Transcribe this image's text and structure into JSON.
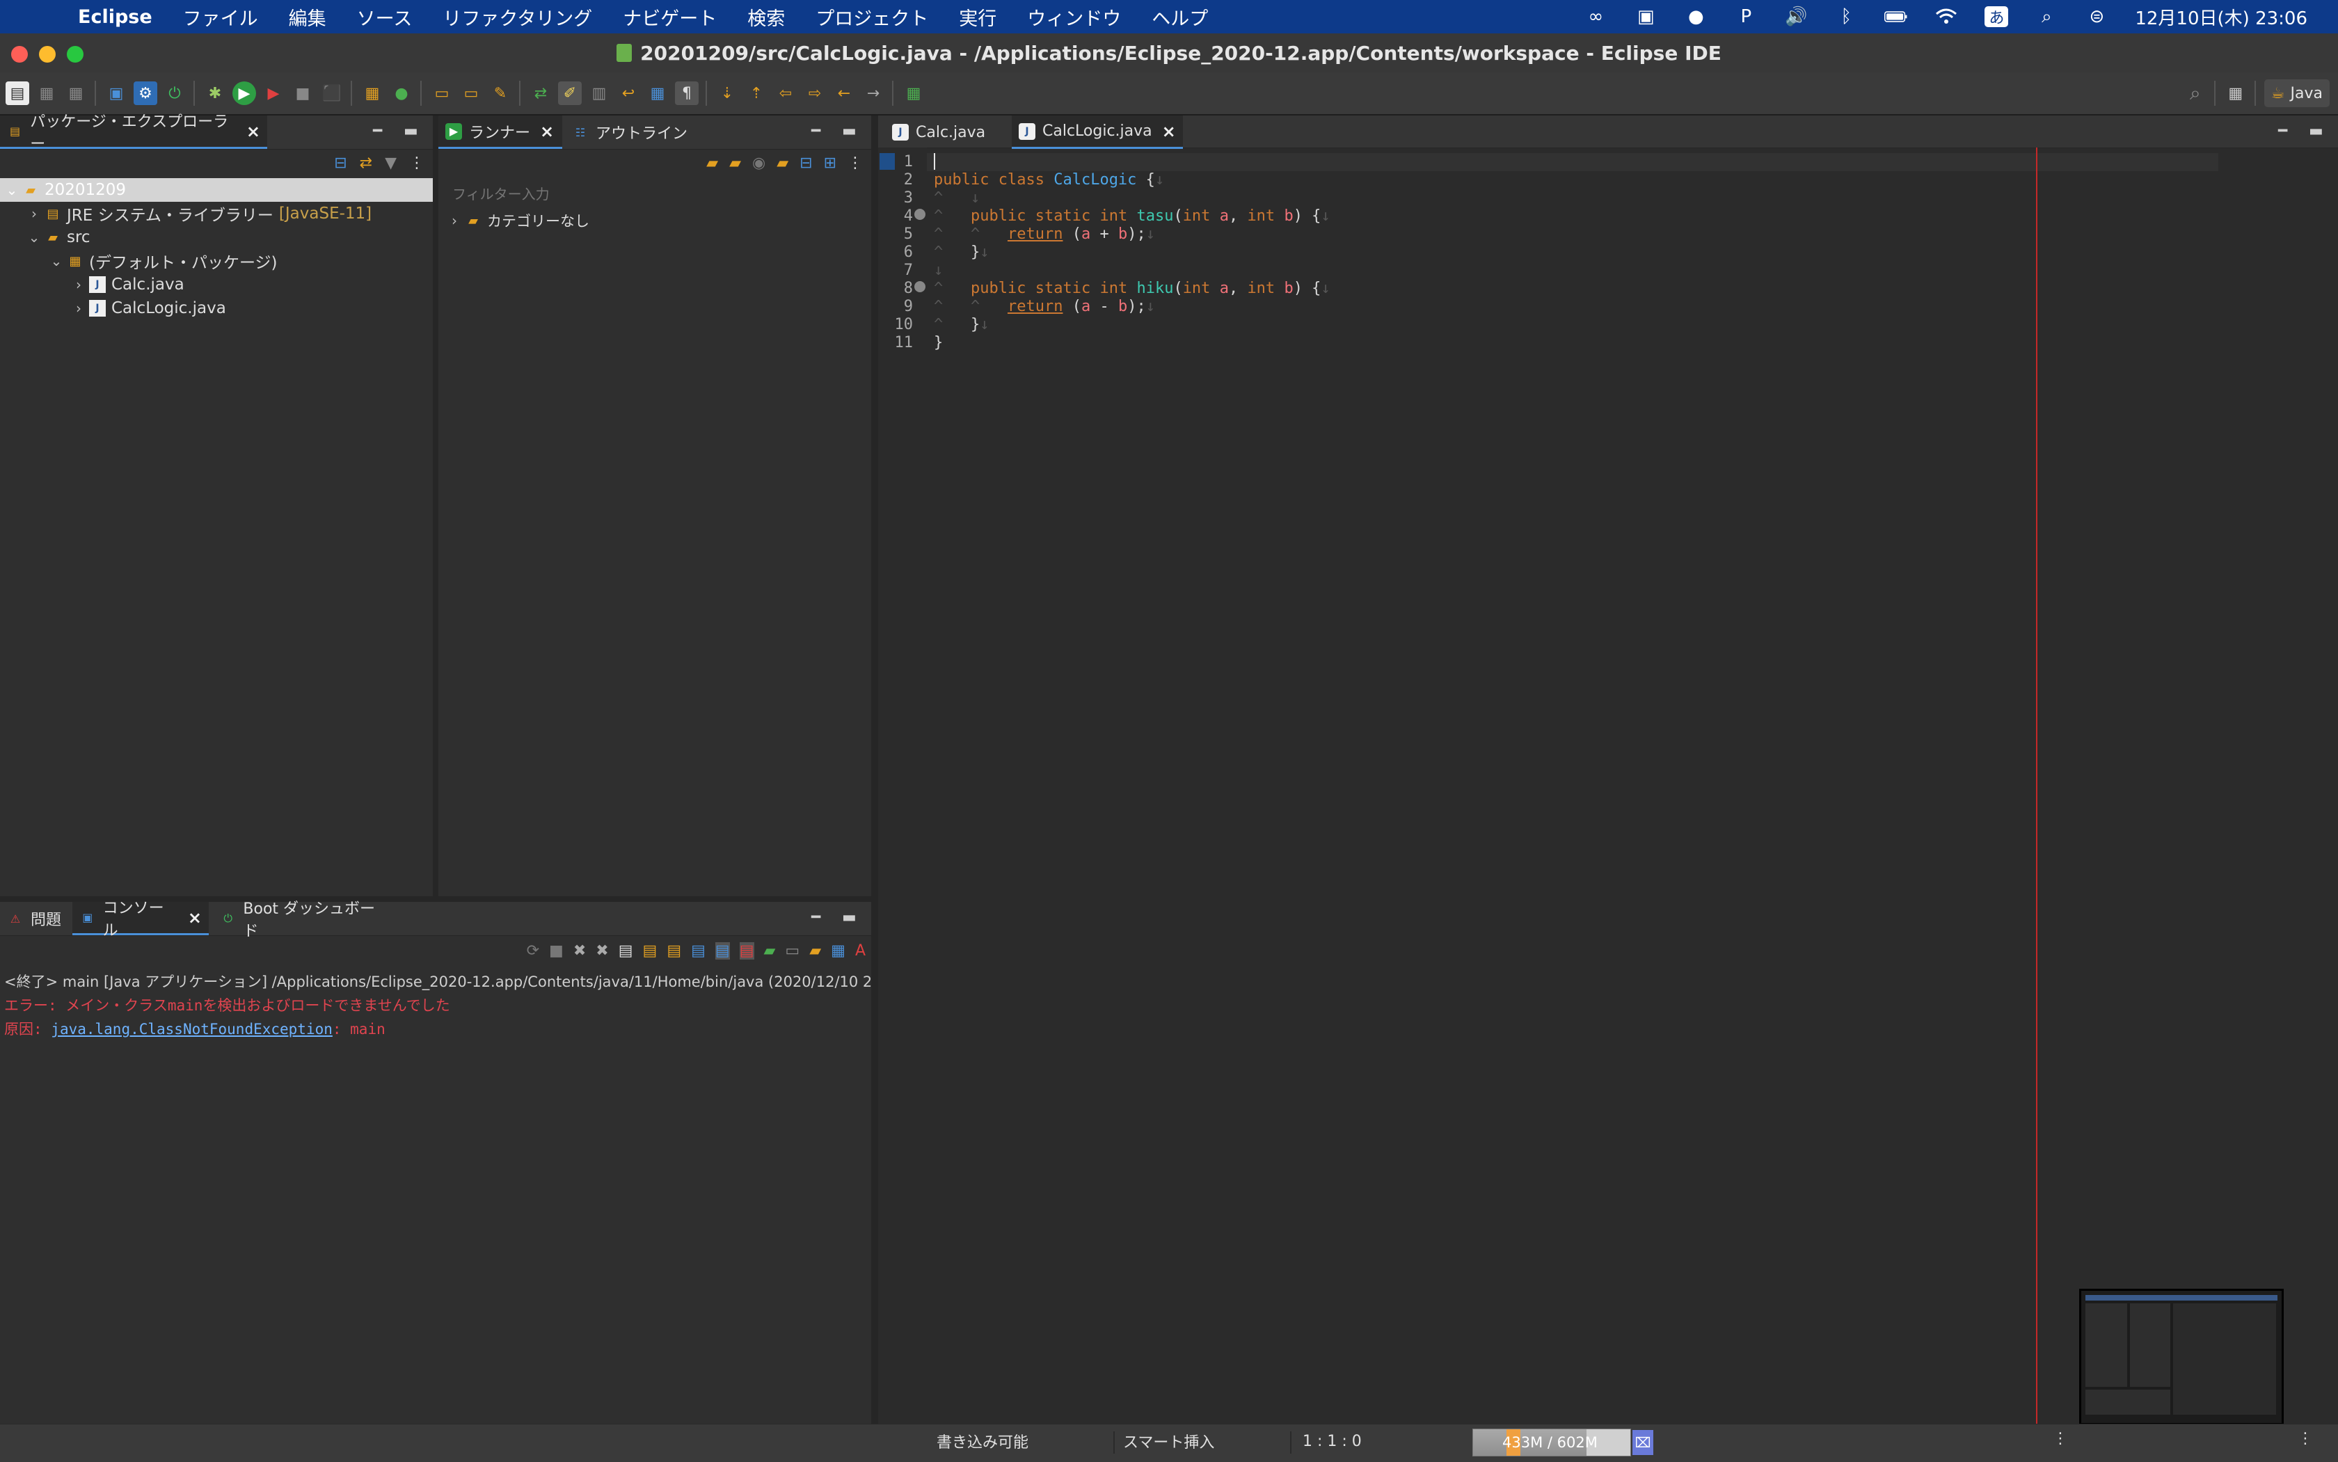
{
  "menubar": {
    "app_name": "Eclipse",
    "items": [
      "ファイル",
      "編集",
      "ソース",
      "リファクタリング",
      "ナビゲート",
      "検索",
      "プロジェクト",
      "実行",
      "ウィンドウ",
      "ヘルプ"
    ],
    "clock": "12月10日(木)  23:06",
    "input_method": "あ"
  },
  "window": {
    "title": "20201209/src/CalcLogic.java - /Applications/Eclipse_2020-12.app/Contents/workspace - Eclipse IDE"
  },
  "toolbar": {
    "perspective_label": "Java"
  },
  "package_explorer": {
    "tab_label": "パッケージ・エクスプローラー",
    "tree": {
      "project": "20201209",
      "jre_label": "JRE システム・ライブラリー",
      "jre_version": "[JavaSE-11]",
      "src": "src",
      "default_package": "(デフォルト・パッケージ)",
      "files": [
        "Calc.java",
        "CalcLogic.java"
      ]
    }
  },
  "runner_panel": {
    "tab_runner": "ランナー",
    "tab_outline": "アウトライン",
    "filter_placeholder": "フィルター入力",
    "category": "カテゴリーなし"
  },
  "console_panel": {
    "tab_problems": "問題",
    "tab_console": "コンソール",
    "tab_boot": "Boot ダッシュボード",
    "header_line": "<終了> main [Java アプリケーション] /Applications/Eclipse_2020-12.app/Contents/java/11/Home/bin/java  (2020/12/10 2",
    "error_line": "エラー: メイン・クラスmainを検出およびロードできませんでした",
    "cause_prefix": "原因: ",
    "cause_link": "java.lang.ClassNotFoundException",
    "cause_suffix": ": main"
  },
  "editor": {
    "tabs": [
      {
        "label": "Calc.java",
        "active": false
      },
      {
        "label": "CalcLogic.java",
        "active": true
      }
    ],
    "line_numbers": [
      "1",
      "2",
      "3",
      "4",
      "5",
      "6",
      "7",
      "8",
      "9",
      "10",
      "11"
    ],
    "code": {
      "l2_public": "public",
      "l2_class": "class",
      "l2_name": "CalcLogic",
      "l2_brace": " {",
      "m_public": "public",
      "m_static": "static",
      "m_int": "int",
      "m1_name": "tasu",
      "m2_name": "hiku",
      "p_int": "int",
      "p_a": "a",
      "p_b": "b",
      "ret": "return",
      "op_plus": "+",
      "op_minus": "-",
      "close": "}",
      "final_close": "}"
    }
  },
  "statusbar": {
    "writable": "書き込み可能",
    "insert_mode": "スマート挿入",
    "position": "1 : 1 : 0",
    "heap": "433M / 602M"
  },
  "colors": {
    "menubar_bg": "#0d3a8a",
    "error_red": "#e0444f",
    "link_blue": "#6fb3ff",
    "keyword_orange": "#cc7832",
    "class_blue": "#4ea7e8",
    "method_teal": "#3ec9b0",
    "print_margin_red": "#c62828"
  }
}
